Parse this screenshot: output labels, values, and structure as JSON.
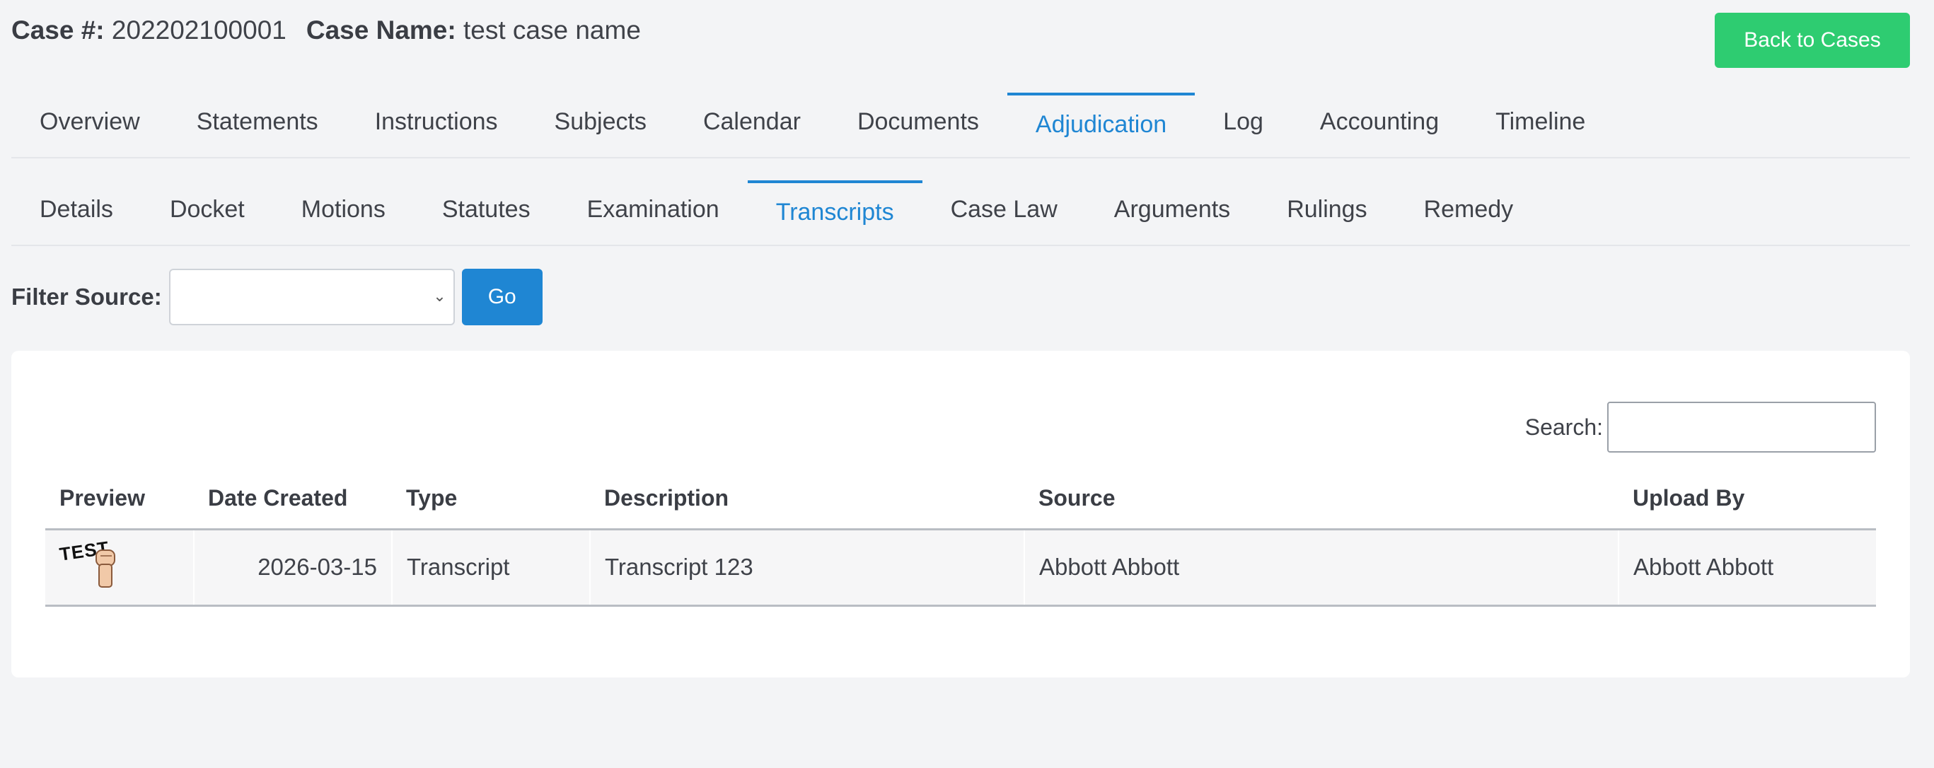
{
  "header": {
    "case_num_label": "Case #:",
    "case_num": "202202100001",
    "case_name_label": "Case Name:",
    "case_name": "test case name",
    "back_label": "Back to Cases"
  },
  "primary_tabs": [
    "Overview",
    "Statements",
    "Instructions",
    "Subjects",
    "Calendar",
    "Documents",
    "Adjudication",
    "Log",
    "Accounting",
    "Timeline"
  ],
  "primary_active": "Adjudication",
  "secondary_tabs": [
    "Details",
    "Docket",
    "Motions",
    "Statutes",
    "Examination",
    "Transcripts",
    "Case Law",
    "Arguments",
    "Rulings",
    "Remedy"
  ],
  "secondary_active": "Transcripts",
  "filter": {
    "label": "Filter Source:",
    "selected": "",
    "go_label": "Go"
  },
  "search": {
    "label": "Search:",
    "value": ""
  },
  "table": {
    "columns": [
      "Preview",
      "Date Created",
      "Type",
      "Description",
      "Source",
      "Upload By"
    ],
    "rows": [
      {
        "preview_text": "TEST",
        "date_created": "2026-03-15",
        "type": "Transcript",
        "description": "Transcript 123",
        "source": "Abbott Abbott",
        "upload_by": "Abbott Abbott"
      }
    ]
  },
  "colors": {
    "accent": "#1f86d3",
    "success": "#2ecc71",
    "background": "#f3f4f6"
  }
}
